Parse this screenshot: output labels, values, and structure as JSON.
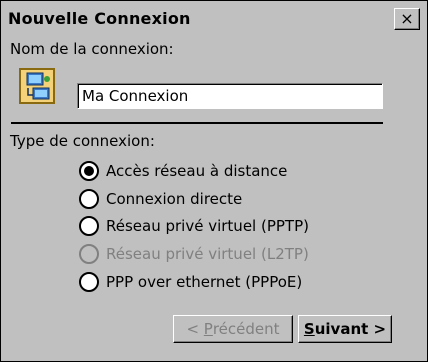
{
  "window": {
    "title": "Nouvelle Connexion",
    "close_label": "×"
  },
  "name_section": {
    "label": "Nom de la connexion:",
    "input_value": "Ma Connexion",
    "icon": "network-connection-icon"
  },
  "type_section": {
    "label": "Type de connexion:",
    "options": [
      {
        "label": "Accès réseau à distance",
        "checked": true,
        "enabled": true
      },
      {
        "label": "Connexion directe",
        "checked": false,
        "enabled": true
      },
      {
        "label": "Réseau privé virtuel (PPTP)",
        "checked": false,
        "enabled": true
      },
      {
        "label": "Réseau privé virtuel (L2TP)",
        "checked": false,
        "enabled": false
      },
      {
        "label": "PPP over ethernet (PPPoE)",
        "checked": false,
        "enabled": true
      }
    ]
  },
  "buttons": {
    "prev_prefix": "< ",
    "prev_access": "P",
    "prev_rest": "récédent",
    "next_access": "S",
    "next_rest": "uivant >"
  }
}
